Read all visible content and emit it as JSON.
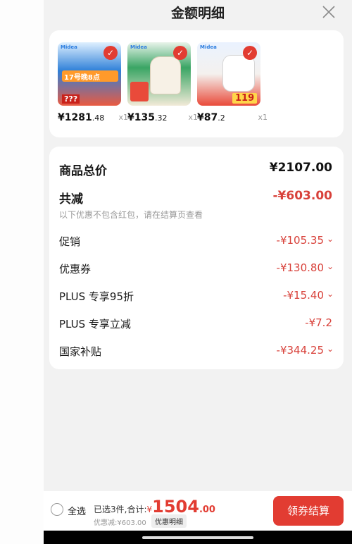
{
  "header": {
    "title": "金额明细"
  },
  "products": [
    {
      "brand": "Midea",
      "price_int": "¥1281",
      "price_dec": ".48",
      "qty": "x1",
      "colors": [
        "#2f80d8",
        "#ea5a40"
      ],
      "badge": "17号晚8点",
      "tag": "???"
    },
    {
      "brand": "Midea",
      "price_int": "¥135",
      "price_dec": ".32",
      "qty": "x1",
      "colors": [
        "#3aa564",
        "#f2ead8"
      ],
      "badge": "",
      "tag": ""
    },
    {
      "brand": "Midea",
      "price_int": "¥87",
      "price_dec": ".2",
      "qty": "x1",
      "colors": [
        "#e94a3a",
        "#f4f1ee"
      ],
      "badge": "",
      "tag": "119"
    }
  ],
  "summary": {
    "total_label": "商品总价",
    "total_value": "¥2107.00",
    "reduce_label": "共减",
    "reduce_value": "-¥603.00",
    "note": "以下优惠不包含红包，请在结算页查看",
    "items": [
      {
        "label": "促销",
        "value": "-¥105.35",
        "chevron": true
      },
      {
        "label": "优惠券",
        "value": "-¥130.80",
        "chevron": true
      },
      {
        "label": "PLUS 专享95折",
        "value": "-¥15.40",
        "chevron": true
      },
      {
        "label": "PLUS 专享立减",
        "value": "-¥7.2",
        "chevron": false
      },
      {
        "label": "国家补贴",
        "value": "-¥344.25",
        "chevron": true
      }
    ]
  },
  "bottom": {
    "select_all": "全选",
    "selected_text": "已选3件,合计:",
    "currency": "¥",
    "amount_int": "1504",
    "amount_dec": ".00",
    "discount_text": "优惠减:¥603.00",
    "detail_label": "优惠明细",
    "checkout_label": "领券结算"
  },
  "colors": {
    "accent": "#e23c32"
  }
}
